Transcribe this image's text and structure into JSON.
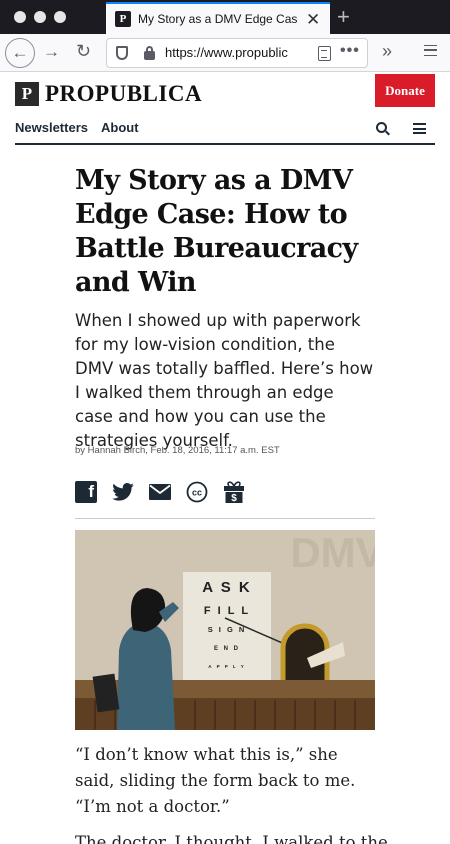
{
  "browser": {
    "tab_title": "My Story as a DMV Edge Case: How to Battle Bureaucracy and Win",
    "tab_favicon": "P",
    "tab_close": "✕",
    "new_tab": "+",
    "url": "https://www.propublica.org/article/dmv-edge-case",
    "url_display": "https://www.propublic",
    "more": "•••",
    "overflow": "»"
  },
  "site": {
    "logo_mark": "P",
    "logo_text": "PROPUBLICA",
    "donate_label": "Donate",
    "nav": [
      {
        "label": "Newsletters"
      },
      {
        "label": "About"
      }
    ]
  },
  "article": {
    "headline": "My Story as a DMV Edge Case: How to Battle Bureaucracy and Win",
    "dek": "When I showed up with paperwork for my low-vision condition, the DMV was totally baffled. Here’s how I walked them through an edge case and how you can use the strategies yourself.",
    "byline": "by Hannah Birch, Feb. 18, 2016, 11:17 a.m. EST",
    "share_icons": [
      "facebook-icon",
      "twitter-icon",
      "email-icon",
      "creative-commons-icon",
      "donate-gift-icon"
    ],
    "illustration": {
      "sign_text": "DMV",
      "eye_chart": [
        "A S K",
        "F I L L",
        "S I G N",
        "E N D",
        "A P P L Y"
      ]
    },
    "paragraph_1": "“I don’t know what this is,” she said, sliding the form back to me. “I’m not a doctor.”",
    "paragraph_2_partial": "The doctor, I thought. I walked to the"
  },
  "colors": {
    "brand_dark": "#1d2a35",
    "donate_red": "#d91b2a",
    "tab_accent": "#0a84ff"
  }
}
